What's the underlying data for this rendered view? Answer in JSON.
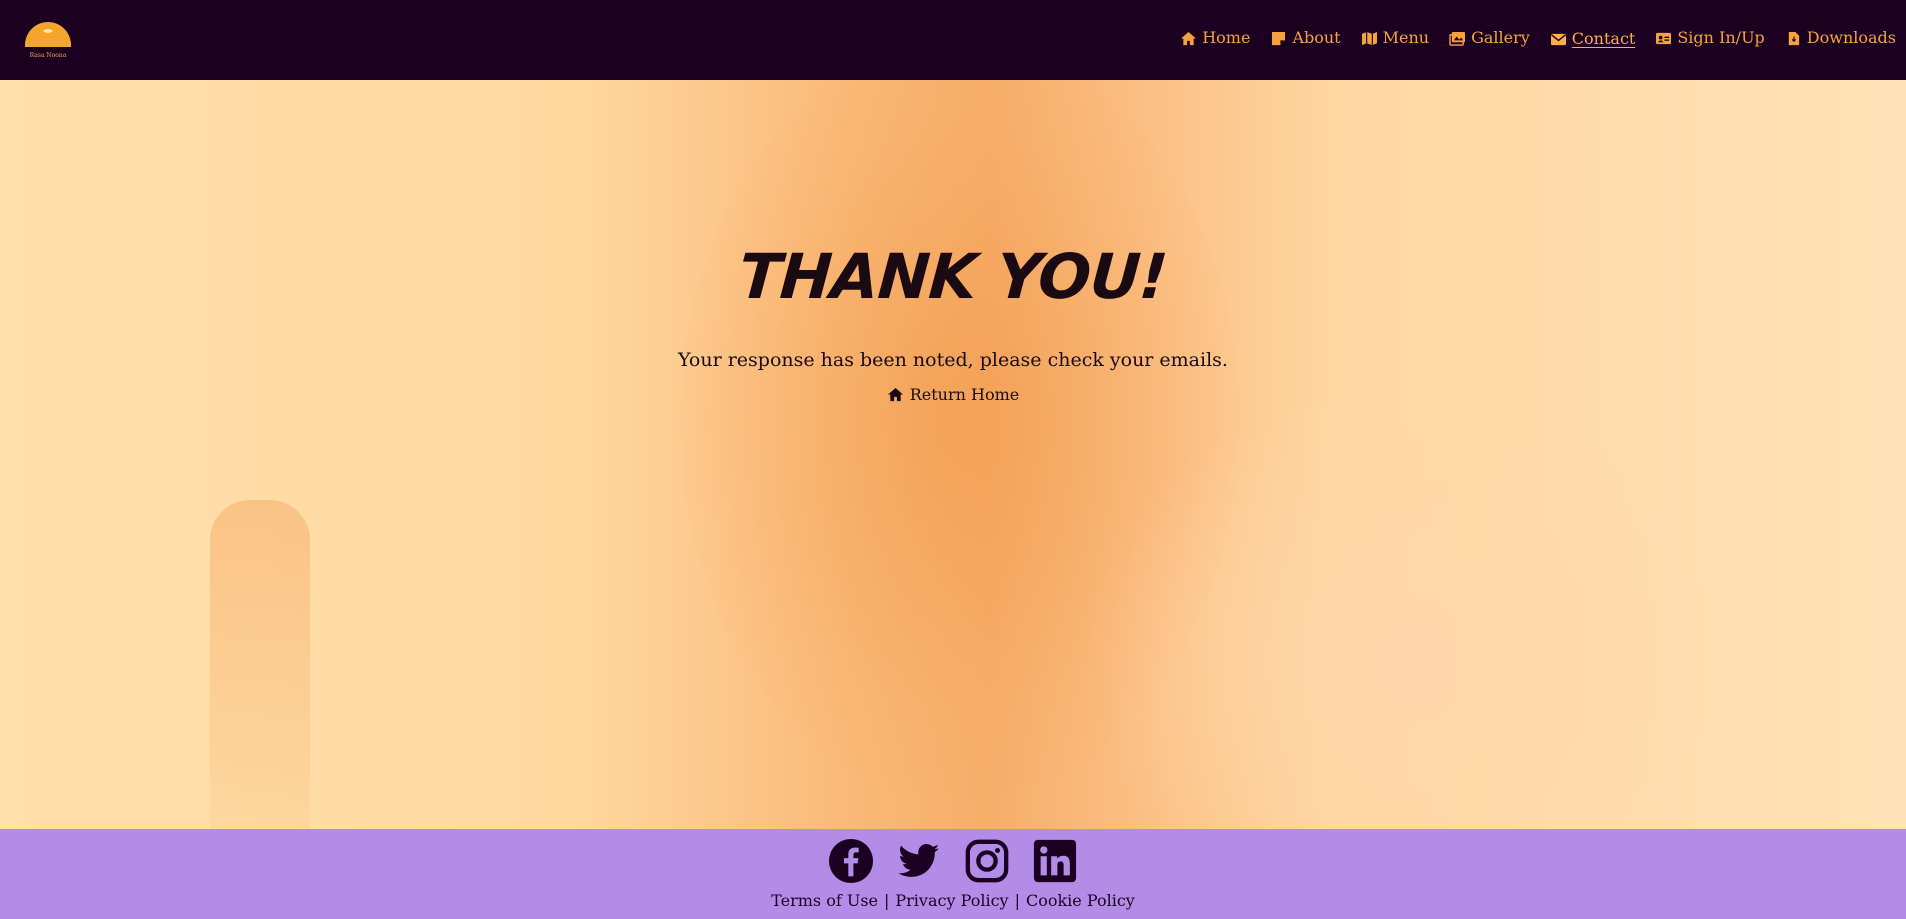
{
  "brand": {
    "name": "Rasa Noona"
  },
  "colors": {
    "header_bg": "#1c0022",
    "nav_text": "#f6a33d",
    "footer_bg": "#b48ce8",
    "hero_tint": "#ffd6a2"
  },
  "nav": {
    "items": [
      {
        "label": "Home",
        "icon": "home-icon"
      },
      {
        "label": "About",
        "icon": "note-icon"
      },
      {
        "label": "Menu",
        "icon": "map-icon"
      },
      {
        "label": "Gallery",
        "icon": "images-icon"
      },
      {
        "label": "Contact",
        "icon": "envelope-icon",
        "active": true
      },
      {
        "label": "Sign In/Up",
        "icon": "id-card-icon"
      },
      {
        "label": "Downloads",
        "icon": "file-icon"
      }
    ]
  },
  "hero": {
    "heading": "THANK YOU!",
    "message": "Your response has been noted, please check your emails.",
    "return_link": "Return Home"
  },
  "footer": {
    "socials": [
      "facebook-icon",
      "twitter-icon",
      "instagram-icon",
      "linkedin-icon"
    ],
    "legal": [
      "Terms of Use",
      "Privacy Policy",
      "Cookie Policy"
    ],
    "separator": "|"
  }
}
